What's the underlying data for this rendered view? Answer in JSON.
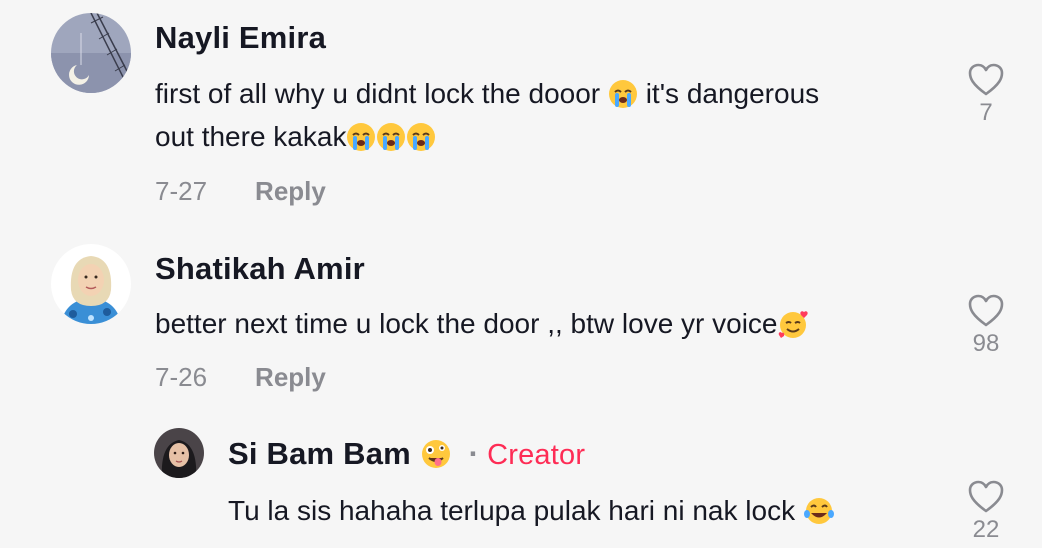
{
  "comments": [
    {
      "username": "Nayli Emira",
      "text_line1": "first of all why u didnt lock the dooor",
      "text_line1_tail": "it's dangerous",
      "text_line2": "out there kakak",
      "date": "7-27",
      "reply_label": "Reply",
      "likes": "7",
      "avatar_icon": "moon-tower-avatar-icon",
      "emoji_icon": "loudly-crying-face-icon"
    },
    {
      "username": "Shatikah Amir",
      "text_line1": "better next time u lock the door ,, btw love yr voice",
      "date": "7-26",
      "reply_label": "Reply",
      "likes": "98",
      "avatar_icon": "hijab-woman-avatar-icon",
      "emoji_icon": "smiling-face-with-hearts-icon"
    }
  ],
  "reply": {
    "username": "Si Bam Bam",
    "badge_separator": "·",
    "badge": "Creator",
    "text": "Tu la sis hahaha terlupa pulak hari ni nak lock",
    "likes": "22",
    "username_emoji_icon": "zany-face-icon",
    "text_emoji_icon": "tears-of-joy-icon"
  },
  "colors": {
    "background": "#f6f6f6",
    "text": "#161823",
    "muted": "#8a8b91",
    "creator": "#fe2c55"
  }
}
